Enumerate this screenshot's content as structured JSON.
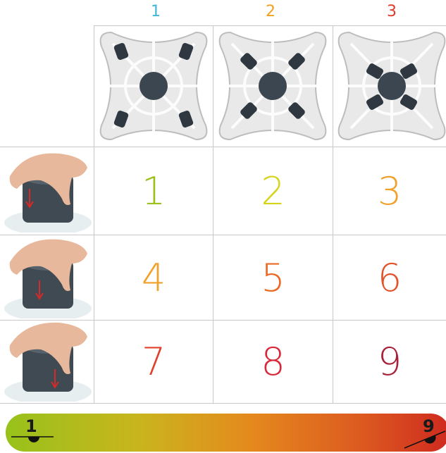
{
  "columns": [
    {
      "label": "1",
      "color": "#3fb7d6"
    },
    {
      "label": "2",
      "color": "#f0a11f"
    },
    {
      "label": "3",
      "color": "#e03a2c"
    }
  ],
  "cells": [
    {
      "label": "1",
      "color": "#9cc01c"
    },
    {
      "label": "2",
      "color": "#d6d41a"
    },
    {
      "label": "3",
      "color": "#f1a12a"
    },
    {
      "label": "4",
      "color": "#f1a12a"
    },
    {
      "label": "5",
      "color": "#ea6a24"
    },
    {
      "label": "6",
      "color": "#e2532a"
    },
    {
      "label": "7",
      "color": "#e0402b"
    },
    {
      "label": "8",
      "color": "#d8283a"
    },
    {
      "label": "9",
      "color": "#a8223a"
    }
  ],
  "scale": {
    "min_label": "1",
    "max_label": "9"
  }
}
